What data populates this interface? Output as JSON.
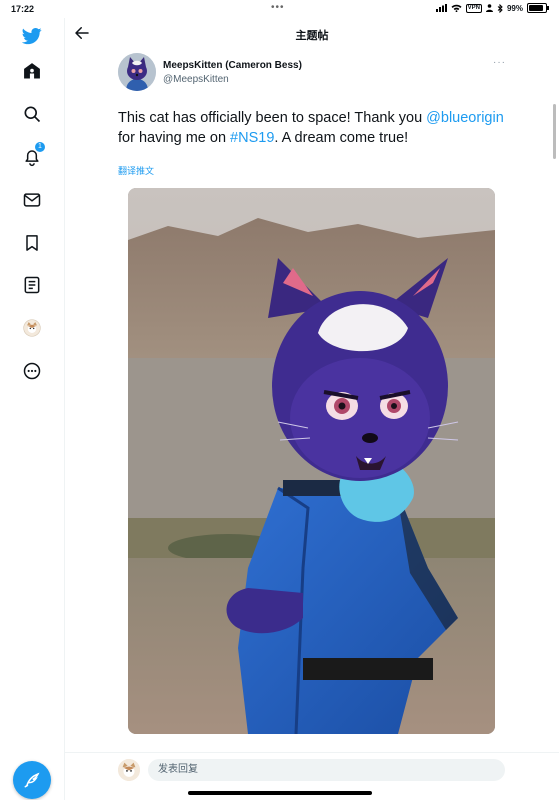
{
  "status_bar": {
    "time": "17:22",
    "battery_text": "99%",
    "icons": [
      "signal-icon",
      "wifi-icon",
      "vpn-icon",
      "person-icon",
      "bluetooth-icon",
      "battery-icon"
    ]
  },
  "header": {
    "title": "主题帖"
  },
  "sidebar": {
    "items": [
      {
        "icon": "twitter-logo-icon"
      },
      {
        "icon": "home-icon"
      },
      {
        "icon": "search-icon"
      },
      {
        "icon": "notifications-icon",
        "badge": "1"
      },
      {
        "icon": "messages-icon"
      },
      {
        "icon": "bookmarks-icon"
      },
      {
        "icon": "lists-icon"
      },
      {
        "icon": "profile-avatar-icon"
      },
      {
        "icon": "more-icon"
      }
    ],
    "compose_icon": "compose-tweet-icon"
  },
  "tweet": {
    "author_name": "MeepsKitten (Cameron Bess)",
    "author_handle": "@MeepsKitten",
    "more": "···",
    "text_part1": "This cat has officially been to space! Thank you ",
    "mention": "@blueorigin",
    "text_part2": " for having me on ",
    "hashtag": "#NS19",
    "text_part3": ". A dream come true!",
    "translate": "翻译推文"
  },
  "reply": {
    "placeholder": "发表回复"
  },
  "colors": {
    "accent": "#1d9bf0",
    "text": "#0f1419",
    "secondary_text": "#536471",
    "divider": "#eff3f4"
  }
}
